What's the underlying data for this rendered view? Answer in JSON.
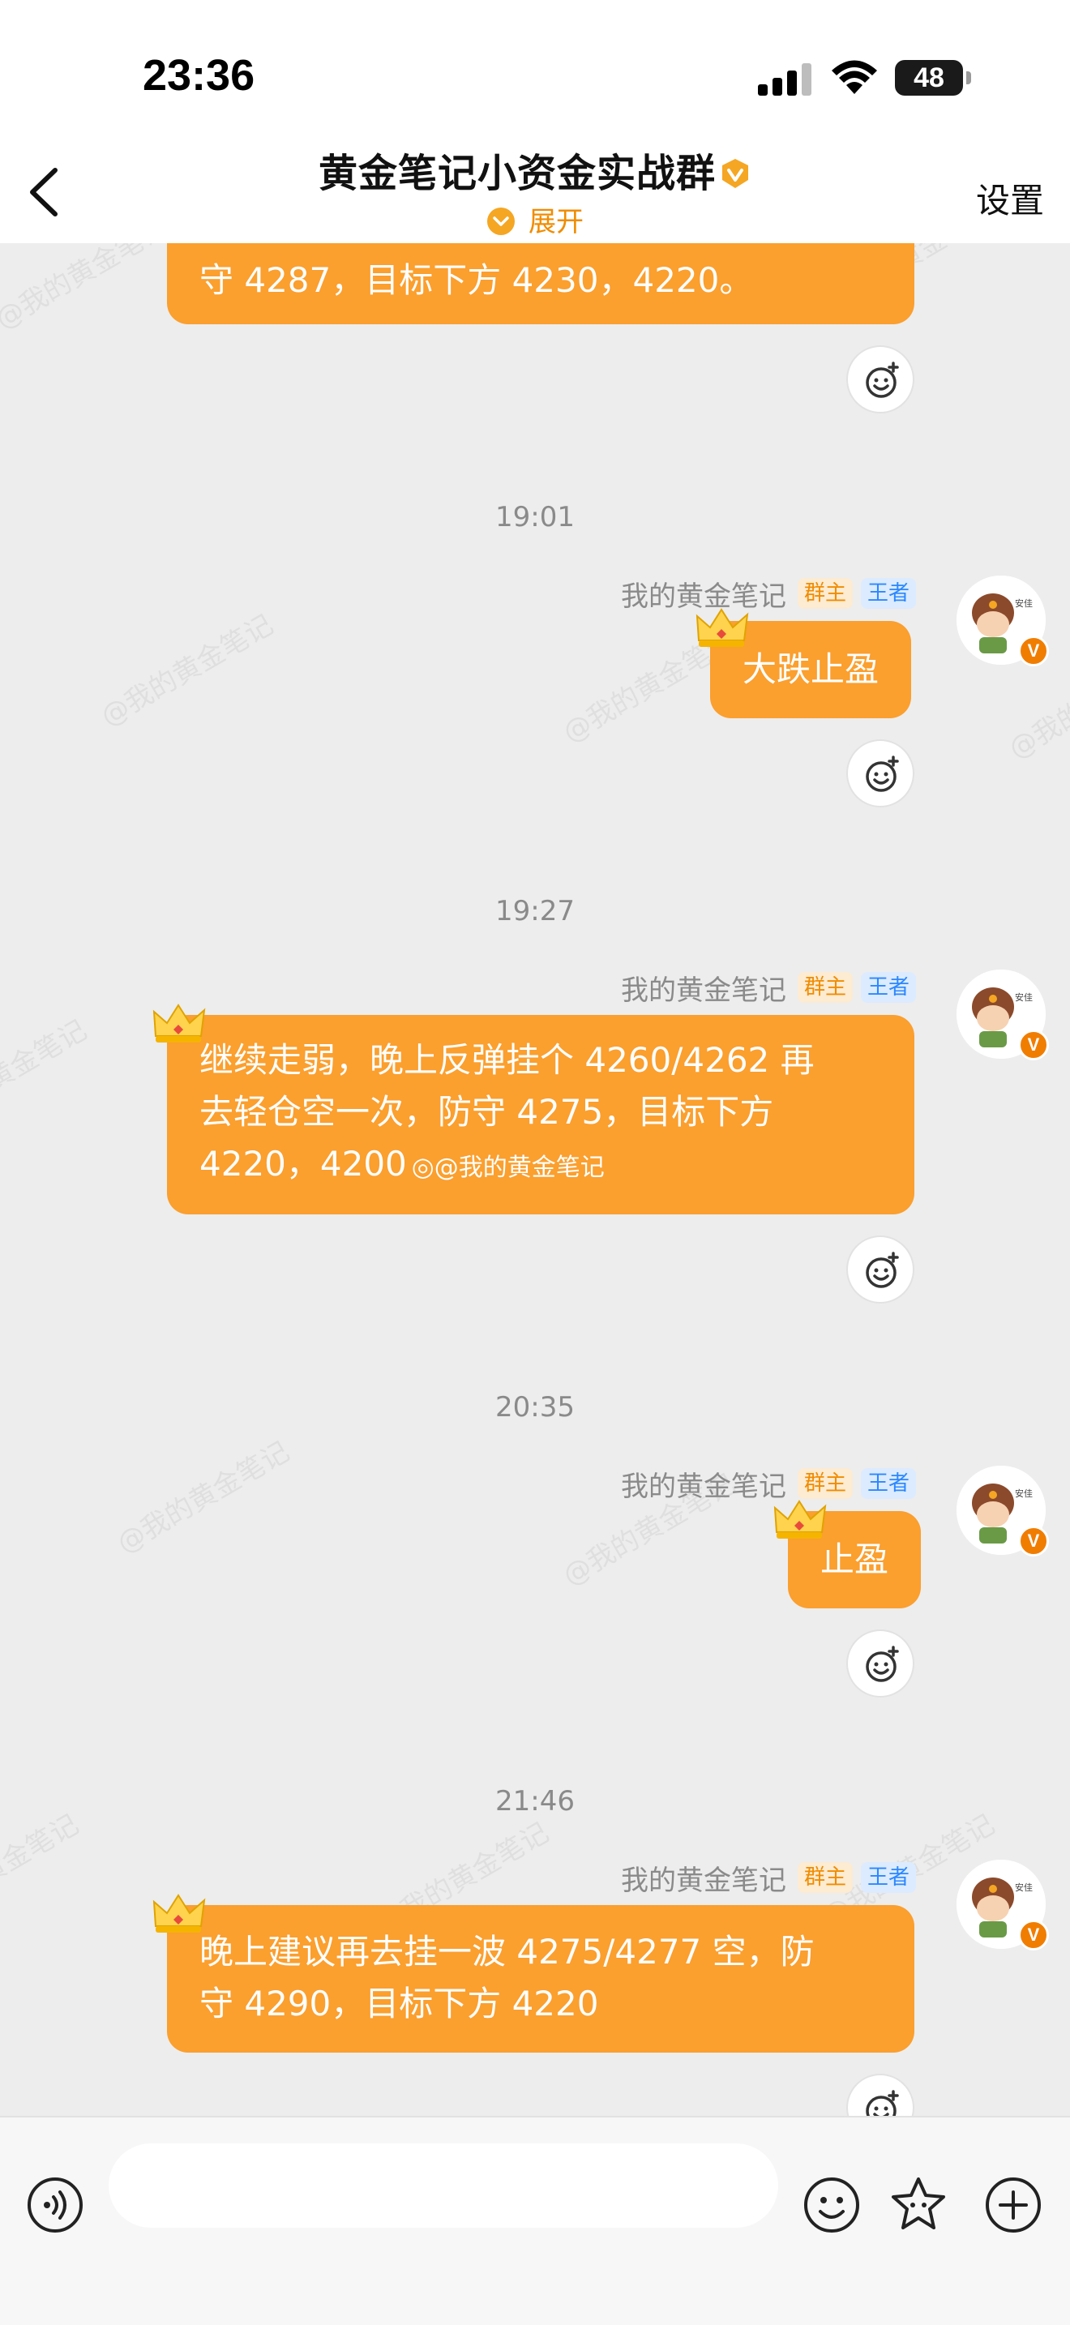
{
  "status_bar": {
    "time": "23:36",
    "battery": "48"
  },
  "header": {
    "title": "黄金笔记小资金实战群",
    "expand_label": "展开",
    "settings_label": "设置"
  },
  "colors": {
    "bubble": "#fb9f2e",
    "accent": "#f08c00",
    "tag_owner_bg": "#fdebd2",
    "tag_king_text": "#2b88ff"
  },
  "watermark_text": "@我的黄金笔记",
  "messages": [
    {
      "text_lines": [
        "守 4287，目标下方 4230，4220。"
      ]
    },
    {
      "time": "19:01",
      "sender": "我的黄金笔记",
      "tag_owner": "群主",
      "tag_king": "王者",
      "text_lines": [
        "大跌止盈"
      ]
    },
    {
      "time": "19:27",
      "sender": "我的黄金笔记",
      "tag_owner": "群主",
      "tag_king": "王者",
      "text_lines": [
        "继续走弱，晚上反弹挂个 4260/4262 再",
        "去轻仓空一次，防守 4275，目标下方",
        "4220，4200"
      ],
      "inline_watermark": "@我的黄金笔记"
    },
    {
      "time": "20:35",
      "sender": "我的黄金笔记",
      "tag_owner": "群主",
      "tag_king": "王者",
      "text_lines": [
        "止盈"
      ]
    },
    {
      "time": "21:46",
      "sender": "我的黄金笔记",
      "tag_owner": "群主",
      "tag_king": "王者",
      "text_lines": [
        "晚上建议再去挂一波 4275/4277 空，防",
        "守 4290，目标下方 4220"
      ]
    }
  ],
  "input": {
    "placeholder": ""
  }
}
